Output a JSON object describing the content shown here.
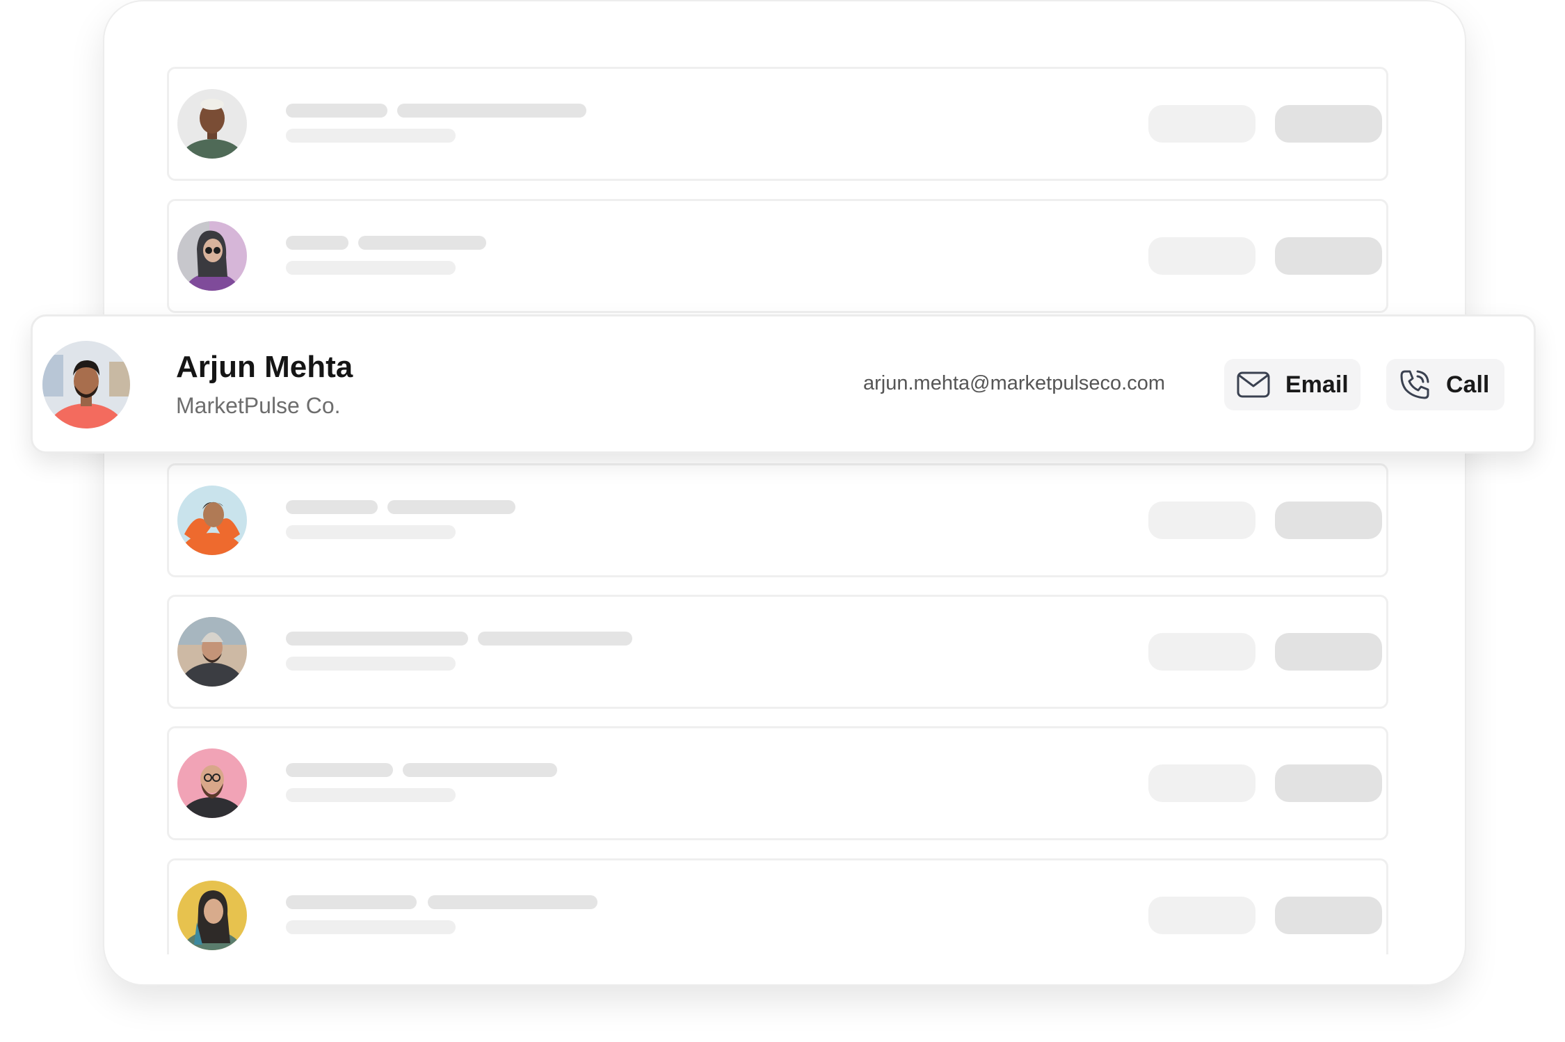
{
  "highlighted_contact": {
    "name": "Arjun Mehta",
    "company": "MarketPulse Co.",
    "email": "arjun.mehta@marketpulseco.com",
    "email_button_label": "Email",
    "call_button_label": "Call"
  },
  "icons": {
    "email": "envelope-icon",
    "call": "phone-icon"
  },
  "colors": {
    "skeleton_dark": "#e2e2e2",
    "skeleton_light": "#f1f1f1",
    "button_bg": "#f4f4f5"
  }
}
